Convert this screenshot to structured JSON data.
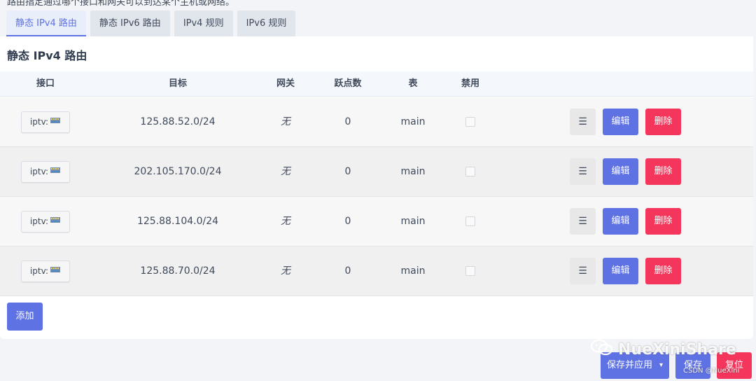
{
  "description": "路由指定通过哪个接口和网关可以到达某个主机或网络。",
  "tabs": [
    {
      "label": "静态 IPv4 路由",
      "active": true
    },
    {
      "label": "静态 IPv6 路由",
      "active": false
    },
    {
      "label": "IPv4 规则",
      "active": false
    },
    {
      "label": "IPv6 规则",
      "active": false
    }
  ],
  "section_title": "静态 IPv4 路由",
  "columns": {
    "interface": "接口",
    "target": "目标",
    "gateway": "网关",
    "metric": "跃点数",
    "table": "表",
    "disabled": "禁用"
  },
  "rows": [
    {
      "interface": "iptv:",
      "target": "125.88.52.0/24",
      "gateway": "无",
      "metric": "0",
      "table": "main",
      "disabled": false
    },
    {
      "interface": "iptv:",
      "target": "202.105.170.0/24",
      "gateway": "无",
      "metric": "0",
      "table": "main",
      "disabled": false
    },
    {
      "interface": "iptv:",
      "target": "125.88.104.0/24",
      "gateway": "无",
      "metric": "0",
      "table": "main",
      "disabled": false
    },
    {
      "interface": "iptv:",
      "target": "125.88.70.0/24",
      "gateway": "无",
      "metric": "0",
      "table": "main",
      "disabled": false
    }
  ],
  "row_actions": {
    "menu": "☰",
    "edit": "编辑",
    "delete": "删除"
  },
  "add_label": "添加",
  "footer": {
    "save_apply": "保存并应用",
    "caret": "▾",
    "save": "保存",
    "reset": "复位"
  },
  "watermark": {
    "text": "NueXiniShare",
    "small": "CSDN @NueXini"
  },
  "icons": {
    "interface": "network-port-icon",
    "menu": "hamburger-icon",
    "watermark": "wechat-icon"
  },
  "colors": {
    "primary": "#5e72e4",
    "danger": "#f5365c",
    "tab_bg": "#e1e5ec",
    "header_bg": "#f4f7fb"
  }
}
